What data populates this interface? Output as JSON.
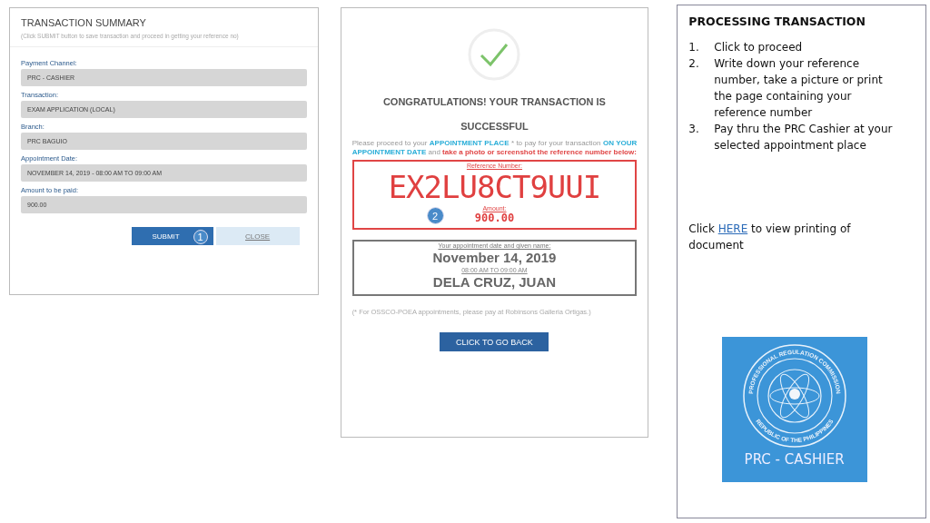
{
  "summary": {
    "title": "TRANSACTION SUMMARY",
    "subtitle": "(Click SUBMIT button to save transaction and proceed in getting your reference no)",
    "fields": [
      {
        "label": "Payment Channel:",
        "value": "PRC - CASHIER"
      },
      {
        "label": "Transaction:",
        "value": "EXAM APPLICATION (LOCAL)"
      },
      {
        "label": "Branch:",
        "value": "PRC BAGUIO"
      },
      {
        "label": "Appointment Date:",
        "value": "NOVEMBER 14, 2019 - 08:00 AM TO 09:00 AM"
      },
      {
        "label": "Amount to be paid:",
        "value": "900.00"
      }
    ],
    "submit": "SUBMIT",
    "close": "CLOSE",
    "step_badge": "1"
  },
  "success": {
    "heading": "CONGRATULATIONS! YOUR TRANSACTION IS SUCCESSFUL",
    "notice": [
      {
        "kind": "plain",
        "text": "Please proceed to your "
      },
      {
        "kind": "highlight",
        "text": "APPOINTMENT PLACE"
      },
      {
        "kind": "plain",
        "text": " * to pay for your transaction "
      },
      {
        "kind": "highlight",
        "text": "ON YOUR APPOINTMENT DATE"
      },
      {
        "kind": "plain",
        "text": " and "
      },
      {
        "kind": "alert",
        "text": "take a photo or screenshot the reference number below:"
      }
    ],
    "reference_label": "Reference Number:",
    "reference": "EX2LU8CT9UUI",
    "step_badge": "2",
    "amount_label": "Amount:",
    "amount": "900.00",
    "appointment_label": "Your appointment date and given name:",
    "appointment_date": "November 14, 2019",
    "appointment_time": "08:00 AM TO 09:00 AM",
    "name": "DELA CRUZ, JUAN",
    "footnote": "(* For OSSCO-POEA appointments, please pay at Robinsons Galleria Ortigas.)",
    "back": "CLICK TO GO BACK"
  },
  "instructions": {
    "title": "PROCESSING TRANSACTION",
    "steps": [
      {
        "number": "1.",
        "text": "Click to proceed"
      },
      {
        "number": "2.",
        "text": "Write down your reference number, take a picture or print the page containing your reference number"
      },
      {
        "number": "3.",
        "text": "Pay thru the PRC Cashier at your selected appointment place"
      }
    ],
    "link_before": "Click ",
    "link": "HERE",
    "link_after": " to view printing of document",
    "logo": {
      "seal_top": "PROFESSIONAL REGULATION COMMISSION",
      "seal_bottom": "REPUBLIC OF THE PHILIPPINES",
      "caption": "PRC - CASHIER"
    }
  }
}
